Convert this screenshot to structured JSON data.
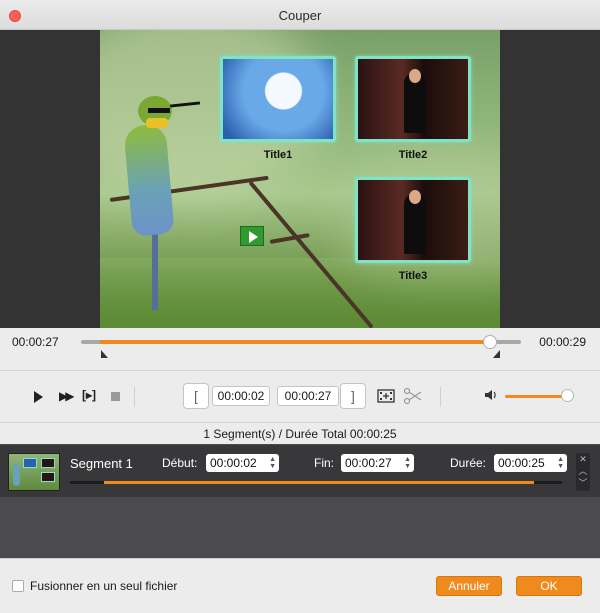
{
  "window": {
    "title": "Couper"
  },
  "preview": {
    "titles": [
      {
        "label": "Title1"
      },
      {
        "label": "Title2"
      },
      {
        "label": "Title3"
      }
    ]
  },
  "timeline": {
    "current_time": "00:00:27",
    "total_time": "00:00:29",
    "progress_fraction": 0.93
  },
  "controls": {
    "segment_button": "[▸]",
    "start_time": "00:00:02",
    "end_time": "00:00:27",
    "bracket_left": "[",
    "bracket_right": "]",
    "volume_fraction": 0.9
  },
  "summary": "1 Segment(s) / Durée Total 00:00:25",
  "segments": [
    {
      "name": "Segment 1",
      "start_label": "Début:",
      "start": "00:00:02",
      "end_label": "Fin:",
      "end": "00:00:27",
      "duration_label": "Durée:",
      "duration": "00:00:25"
    }
  ],
  "footer": {
    "merge_label": "Fusionner en un seul fichier",
    "merge_checked": false,
    "cancel_label": "Annuler",
    "ok_label": "OK"
  },
  "colors": {
    "accent": "#f08a1c",
    "close": "#fc5f57",
    "highlight": "#7fe3c4"
  }
}
